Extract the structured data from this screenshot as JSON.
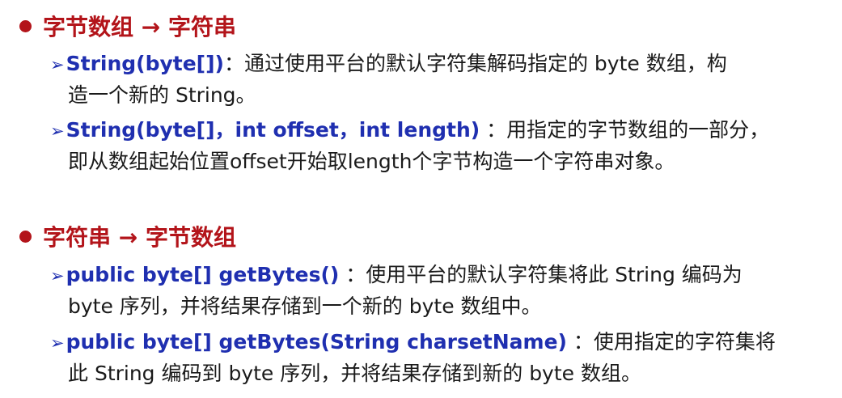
{
  "sections": [
    {
      "heading": "字节数组 → 字符串",
      "items": [
        {
          "method": "String(byte[])",
          "line1_desc": "：通过使用平台的默认字符集解码指定的 byte 数组，构",
          "line2": "造一个新的 String。"
        },
        {
          "method": "String(byte[]，int offset，int length)",
          "line1_desc": " ：用指定的字节数组的一部分，",
          "line2": "即从数组起始位置offset开始取length个字节构造一个字符串对象。"
        }
      ]
    },
    {
      "heading": "字符串 → 字节数组",
      "items": [
        {
          "method": "public byte[] getBytes()",
          "line1_desc": " ：使用平台的默认字符集将此 String 编码为",
          "line2": "byte 序列，并将结果存储到一个新的 byte 数组中。"
        },
        {
          "method": "public byte[] getBytes(String charsetName)",
          "line1_desc": " ：使用指定的字符集将",
          "line2": "此 String 编码到 byte 序列，并将结果存储到新的 byte 数组。"
        }
      ]
    }
  ],
  "icons": {
    "bullet": "red-dot-bullet-icon",
    "item_marker": "arrow-bullet-icon"
  },
  "colors": {
    "heading": "#b3141a",
    "method": "#1f2fb0",
    "text": "#1a1a1a",
    "background": "#ffffff"
  }
}
